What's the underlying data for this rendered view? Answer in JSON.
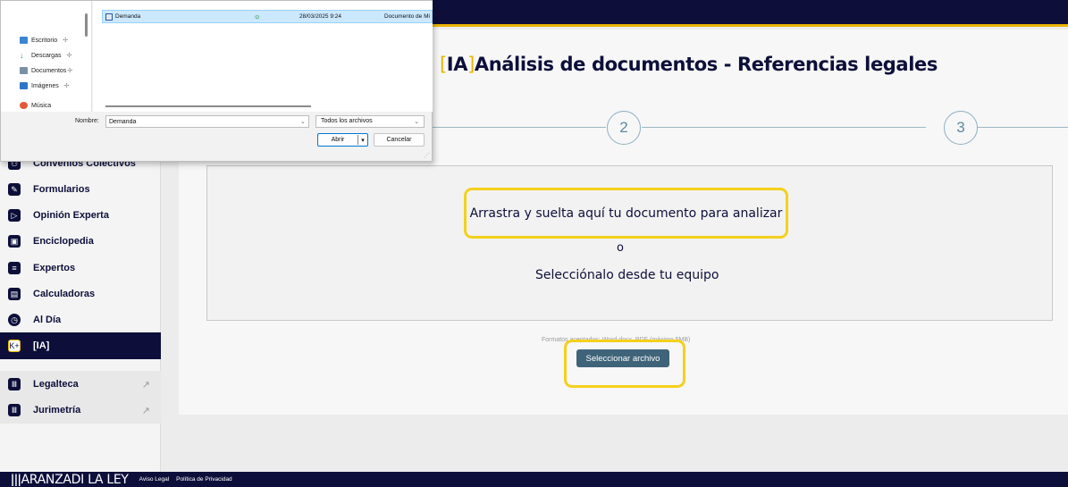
{
  "dialog": {
    "nav_items": [
      {
        "label": "Escritorio",
        "icon": "desktop-icon",
        "color": "#3a86d4"
      },
      {
        "label": "Descargas",
        "icon": "download-icon",
        "color": "#2d9b3f"
      },
      {
        "label": "Documentos",
        "icon": "documents-icon",
        "color": "#7a8fa3"
      },
      {
        "label": "Imágenes",
        "icon": "pictures-icon",
        "color": "#2f75c8"
      },
      {
        "label": "Música",
        "icon": "music-icon",
        "color": "#e2593b"
      }
    ],
    "file": {
      "name": "Demanda",
      "status_icon": "sync-ok-icon",
      "modified": "28/03/2025 9:24",
      "type": "Documento de Mi"
    },
    "filename_label": "Nombre:",
    "filename_value": "Demanda",
    "filetype_value": "Todos los archivos",
    "open_label": "Abrir",
    "cancel_label": "Cancelar"
  },
  "sidebar": {
    "items": [
      {
        "label": "Convenios Colectivos",
        "icon": "handshake-icon"
      },
      {
        "label": "Formularios",
        "icon": "edit-form-icon"
      },
      {
        "label": "Opinión Experta",
        "icon": "expert-opinion-icon"
      },
      {
        "label": "Enciclopedia",
        "icon": "encyclopedia-icon"
      },
      {
        "label": "Expertos",
        "icon": "list-icon"
      },
      {
        "label": "Calculadoras",
        "icon": "calculator-icon"
      },
      {
        "label": "Al Día",
        "icon": "clock-icon"
      },
      {
        "label": "[IA]",
        "icon": "k-plus-icon",
        "active": true
      }
    ],
    "external": [
      {
        "label": "Legalteca",
        "icon": "legalteca-icon",
        "arrow": "↗"
      },
      {
        "label": "Jurimetría",
        "icon": "jurimetria-icon",
        "arrow": "↗"
      }
    ]
  },
  "main": {
    "title_prefix": "IA",
    "title": "Análisis de documentos - Referencias legales",
    "steps": [
      "2",
      "3"
    ],
    "drop_text": "Arrastra y suelta aquí tu documento para analizar",
    "or_text": "o",
    "select_text": "Selecciónalo desde tu equipo",
    "formats_text": "Formatos aceptados: Word docx, PDF (máximo 5MB)",
    "select_button": "Seleccionar archivo"
  },
  "footer": {
    "logo": "ARANZADI LA LEY",
    "links": [
      "Aviso Legal",
      "Política de Privacidad"
    ]
  },
  "colors": {
    "brand_navy": "#0d0f3a",
    "accent_yellow": "#e8b400",
    "button_blue": "#3f6479"
  }
}
